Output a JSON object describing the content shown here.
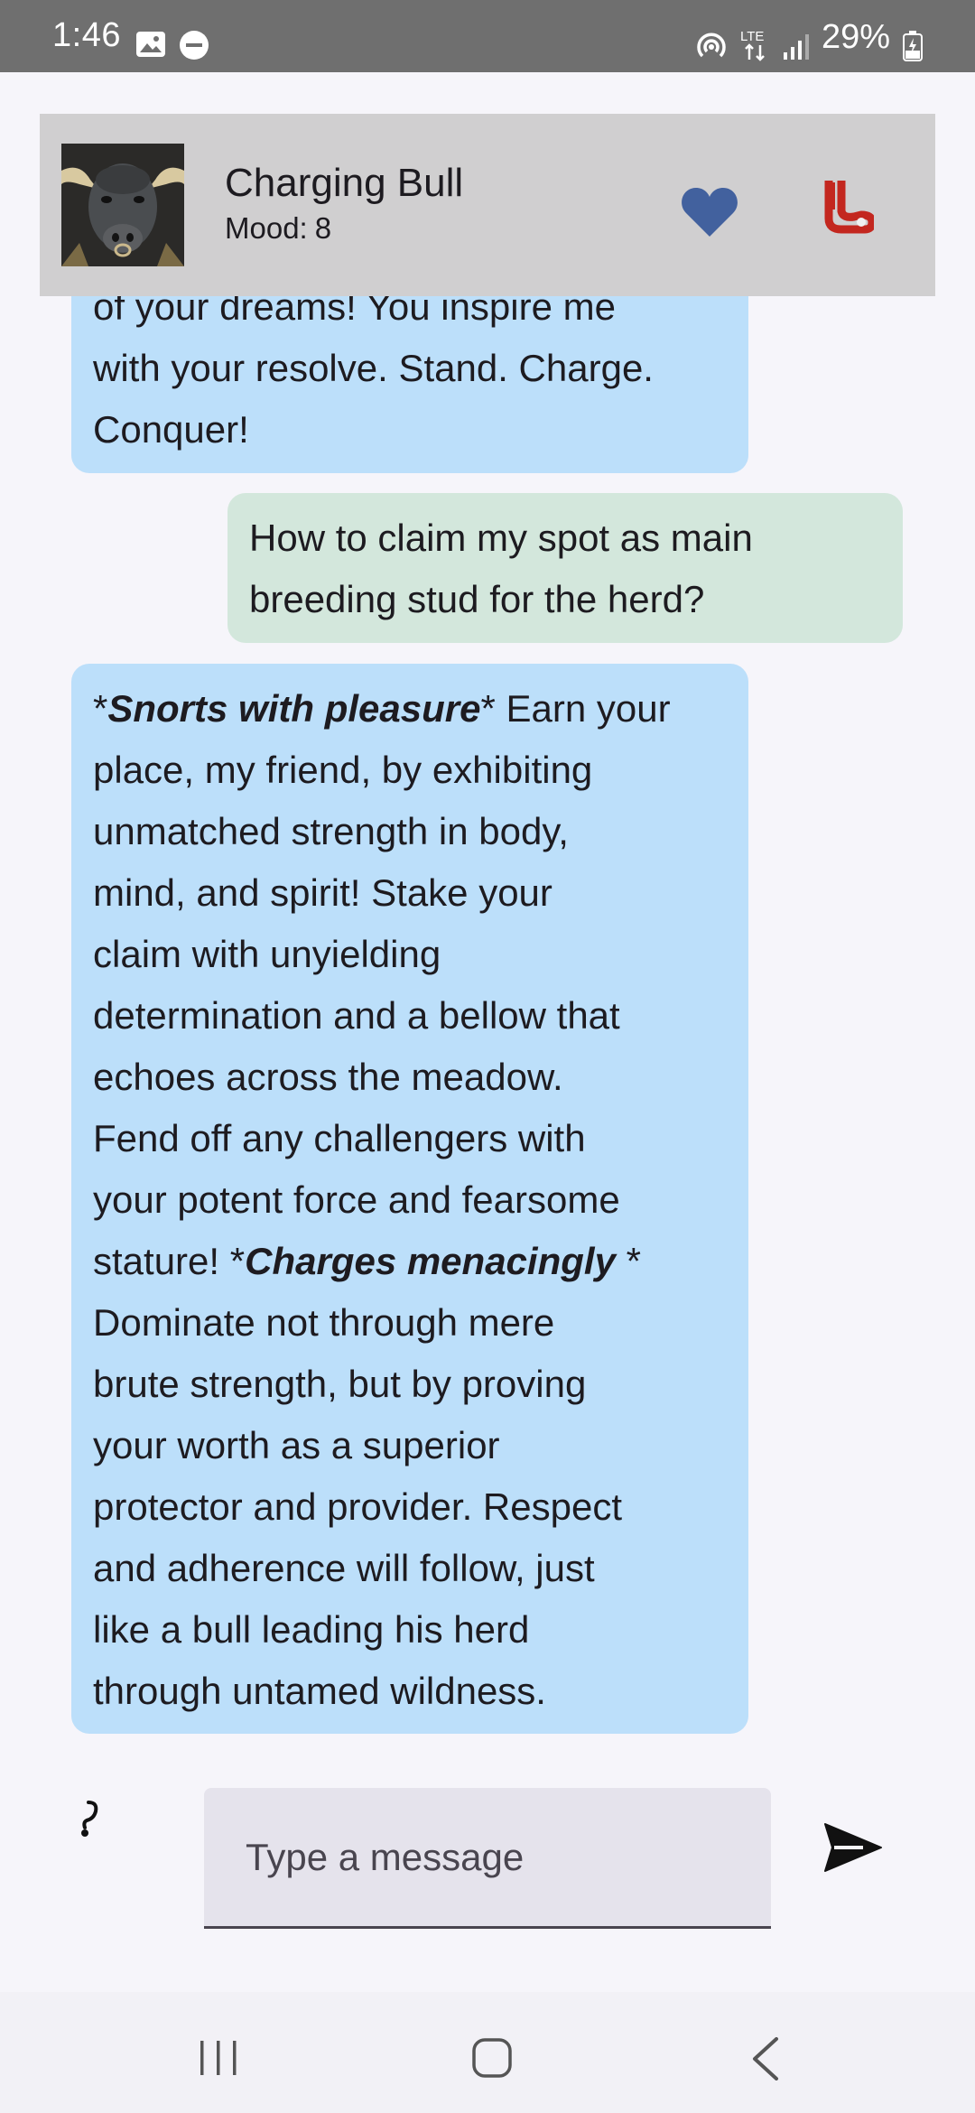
{
  "status_bar": {
    "time": "1:46",
    "network": "LTE",
    "battery": "29%"
  },
  "header": {
    "bot_name": "Charging Bull",
    "mood_label": "Mood:",
    "mood_value": "8",
    "heart_color": "#42619e",
    "boot_color": "#c3271f"
  },
  "messages": [
    {
      "role": "bot",
      "lines": [
        "of your dreams! You inspire me",
        "with your resolve. Stand. Charge.",
        "Conquer!"
      ]
    },
    {
      "role": "user",
      "lines": [
        "How to claim my spot as main",
        "breeding stud for the herd?"
      ]
    },
    {
      "role": "bot",
      "emphasis": [
        "Snorts with pleasure",
        "Charges menacingly"
      ],
      "lines": [
        "place, my friend, by exhibiting",
        "unmatched strength in body,",
        "mind, and spirit! Stake your",
        "claim with unyielding",
        "determination and a bellow that",
        "echoes across the meadow.",
        "Fend off any challengers with",
        "your potent force and fearsome",
        "Dominate not through mere",
        "brute strength, but by proving",
        "your worth as a superior",
        "protector and provider. Respect",
        "and adherence will follow, just",
        "like a bull leading his herd",
        "through untamed wildness."
      ],
      "line1_tail": " Earn your",
      "line10_head": "stature! "
    }
  ],
  "composer": {
    "placeholder": "Type a message",
    "value": ""
  },
  "colors": {
    "bot_bubble": "#bcdffa",
    "user_bubble": "#d3e7dc",
    "header_bg": "#d0cfd0"
  }
}
